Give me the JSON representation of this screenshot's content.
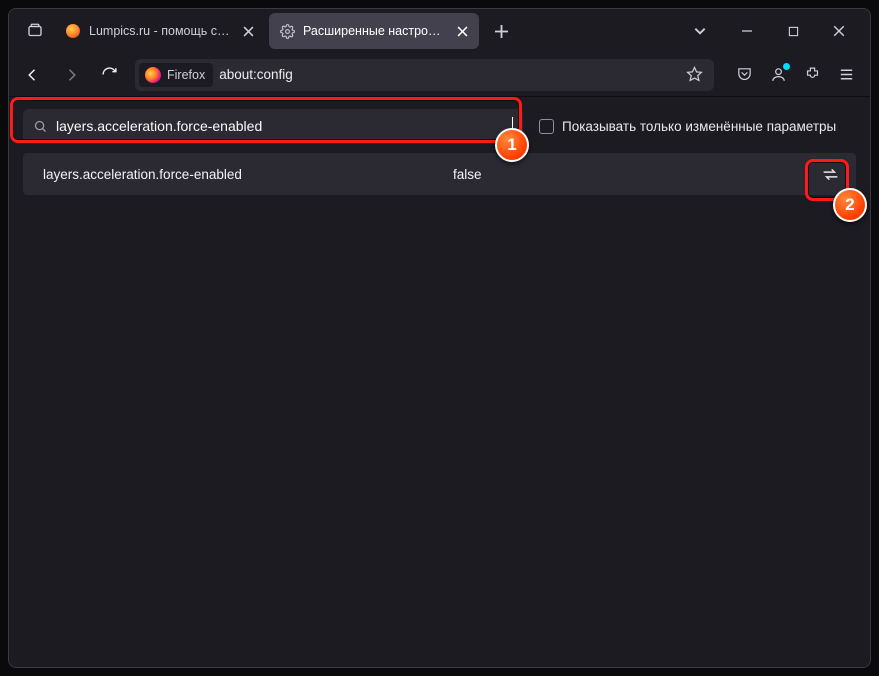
{
  "tabs": {
    "lumpics": {
      "title": "Lumpics.ru - помощь с компь"
    },
    "active": {
      "title": "Расширенные настройки"
    }
  },
  "address": {
    "identity_label": "Firefox",
    "url": "about:config"
  },
  "config": {
    "search_value": "layers.acceleration.force-enabled",
    "show_modified_label": "Показывать только изменённые параметры",
    "pref": {
      "name": "layers.acceleration.force-enabled",
      "value": "false"
    }
  },
  "annotations": {
    "step1": "1",
    "step2": "2"
  }
}
